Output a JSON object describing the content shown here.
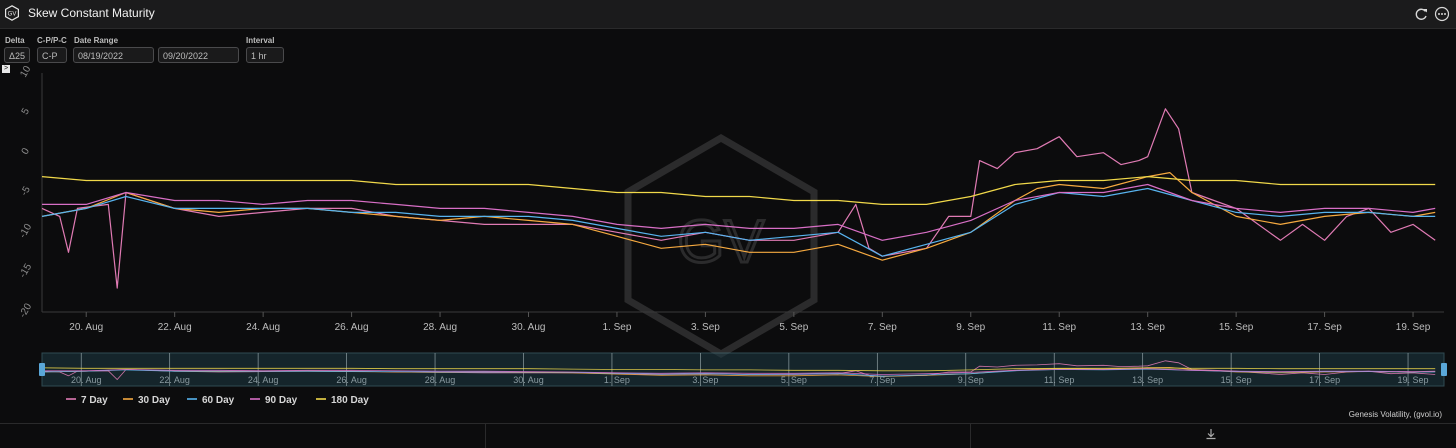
{
  "header": {
    "title": "Skew Constant Maturity",
    "logo_text": "GV",
    "refresh_icon": "refresh-icon",
    "menu_icon": "more-icon"
  },
  "controls": {
    "delta": {
      "label": "Delta",
      "value": "Δ25"
    },
    "mode": {
      "label": "C-P/P-C",
      "value": "C-P"
    },
    "date_range": {
      "label": "Date Range",
      "start": "08/19/2022",
      "end": "09/20/2022"
    },
    "interval": {
      "label": "Interval",
      "value": "1 hr"
    },
    "toggle_glyph": ">"
  },
  "credit": "Genesis Volatility, (gvol.io)",
  "colors": {
    "s7": "#e07bb4",
    "s30": "#f5a940",
    "s60": "#58b4ef",
    "s90": "#d86fc6",
    "s180": "#f1d94a"
  },
  "chart_data": {
    "type": "line",
    "title": "",
    "xlabel": "",
    "ylabel": "",
    "ylim": [
      -20,
      10
    ],
    "yticks": [
      "10",
      "5",
      "0",
      "-5",
      "-10",
      "-15",
      "-20"
    ],
    "xrange_days": [
      0,
      31.7
    ],
    "xticks": [
      {
        "day": 1,
        "label": "20. Aug"
      },
      {
        "day": 3,
        "label": "22. Aug"
      },
      {
        "day": 5,
        "label": "24. Aug"
      },
      {
        "day": 7,
        "label": "26. Aug"
      },
      {
        "day": 9,
        "label": "28. Aug"
      },
      {
        "day": 11,
        "label": "30. Aug"
      },
      {
        "day": 13,
        "label": "1. Sep"
      },
      {
        "day": 15,
        "label": "3. Sep"
      },
      {
        "day": 17,
        "label": "5. Sep"
      },
      {
        "day": 19,
        "label": "7. Sep"
      },
      {
        "day": 21,
        "label": "9. Sep"
      },
      {
        "day": 23,
        "label": "11. Sep"
      },
      {
        "day": 25,
        "label": "13. Sep"
      },
      {
        "day": 27,
        "label": "15. Sep"
      },
      {
        "day": 29,
        "label": "17. Sep"
      },
      {
        "day": 31,
        "label": "19. Sep"
      }
    ],
    "legend_position": "bottom-left",
    "series": [
      {
        "name": "7 Day",
        "color": "#e07bb4",
        "points": [
          [
            0,
            -7
          ],
          [
            0.4,
            -8
          ],
          [
            0.6,
            -12.5
          ],
          [
            0.8,
            -7
          ],
          [
            1.5,
            -6.5
          ],
          [
            1.7,
            -17
          ],
          [
            1.9,
            -5
          ],
          [
            3,
            -7
          ],
          [
            4,
            -8
          ],
          [
            5,
            -7.5
          ],
          [
            6,
            -7
          ],
          [
            7,
            -7
          ],
          [
            8,
            -8
          ],
          [
            9,
            -8.5
          ],
          [
            10,
            -9
          ],
          [
            11,
            -9
          ],
          [
            12,
            -9
          ],
          [
            13,
            -10
          ],
          [
            14,
            -11
          ],
          [
            15,
            -10
          ],
          [
            16,
            -11
          ],
          [
            17,
            -11
          ],
          [
            18,
            -10
          ],
          [
            18.4,
            -6.5
          ],
          [
            18.7,
            -12
          ],
          [
            19,
            -13
          ],
          [
            20,
            -12
          ],
          [
            20.5,
            -8
          ],
          [
            21,
            -8
          ],
          [
            21.2,
            -1
          ],
          [
            21.6,
            -2
          ],
          [
            22,
            0
          ],
          [
            22.5,
            0.5
          ],
          [
            23,
            2
          ],
          [
            23.4,
            -0.5
          ],
          [
            24,
            0
          ],
          [
            24.4,
            -1.5
          ],
          [
            24.8,
            -1
          ],
          [
            25,
            -0.5
          ],
          [
            25.4,
            5.5
          ],
          [
            25.7,
            3
          ],
          [
            26,
            -5
          ],
          [
            26.5,
            -6
          ],
          [
            27,
            -7
          ],
          [
            27.5,
            -9
          ],
          [
            28,
            -11
          ],
          [
            28.5,
            -9
          ],
          [
            29,
            -11
          ],
          [
            29.5,
            -8
          ],
          [
            30,
            -7
          ],
          [
            30.5,
            -10
          ],
          [
            31,
            -9
          ],
          [
            31.5,
            -11
          ]
        ]
      },
      {
        "name": "30 Day",
        "color": "#f5a940",
        "points": [
          [
            0,
            -8
          ],
          [
            1,
            -7
          ],
          [
            1.9,
            -5
          ],
          [
            3,
            -7
          ],
          [
            4,
            -7.5
          ],
          [
            5,
            -7
          ],
          [
            6,
            -7
          ],
          [
            7,
            -7.5
          ],
          [
            8,
            -8
          ],
          [
            9,
            -8.5
          ],
          [
            10,
            -8
          ],
          [
            11,
            -8.5
          ],
          [
            12,
            -9
          ],
          [
            13,
            -10.5
          ],
          [
            14,
            -12
          ],
          [
            15,
            -11.5
          ],
          [
            16,
            -12.5
          ],
          [
            17,
            -12.5
          ],
          [
            18,
            -11.5
          ],
          [
            19,
            -13.5
          ],
          [
            20,
            -12
          ],
          [
            21,
            -10
          ],
          [
            22,
            -6
          ],
          [
            22.5,
            -4.5
          ],
          [
            23,
            -4
          ],
          [
            24,
            -4.5
          ],
          [
            25,
            -3
          ],
          [
            25.5,
            -2.5
          ],
          [
            26,
            -5
          ],
          [
            27,
            -8
          ],
          [
            28,
            -9
          ],
          [
            29,
            -8
          ],
          [
            30,
            -7.5
          ],
          [
            31,
            -8
          ],
          [
            31.5,
            -7.5
          ]
        ]
      },
      {
        "name": "60 Day",
        "color": "#58b4ef",
        "points": [
          [
            0,
            -8
          ],
          [
            1,
            -7
          ],
          [
            1.9,
            -5.5
          ],
          [
            3,
            -7
          ],
          [
            4,
            -7
          ],
          [
            5,
            -7
          ],
          [
            6,
            -7
          ],
          [
            7,
            -7.5
          ],
          [
            8,
            -7.5
          ],
          [
            9,
            -8
          ],
          [
            10,
            -8
          ],
          [
            11,
            -8
          ],
          [
            12,
            -8.5
          ],
          [
            13,
            -9.5
          ],
          [
            14,
            -10.5
          ],
          [
            15,
            -10
          ],
          [
            16,
            -11
          ],
          [
            17,
            -10.5
          ],
          [
            18,
            -10
          ],
          [
            19,
            -13
          ],
          [
            20,
            -11.5
          ],
          [
            21,
            -10
          ],
          [
            22,
            -6.5
          ],
          [
            23,
            -5
          ],
          [
            24,
            -5.5
          ],
          [
            25,
            -4.5
          ],
          [
            26,
            -6
          ],
          [
            27,
            -7.5
          ],
          [
            28,
            -8
          ],
          [
            29,
            -7.5
          ],
          [
            30,
            -7.5
          ],
          [
            31,
            -8
          ],
          [
            31.5,
            -8
          ]
        ]
      },
      {
        "name": "90 Day",
        "color": "#d86fc6",
        "points": [
          [
            0,
            -6.5
          ],
          [
            1,
            -6.5
          ],
          [
            1.9,
            -5
          ],
          [
            3,
            -6
          ],
          [
            4,
            -6
          ],
          [
            5,
            -6.5
          ],
          [
            6,
            -6
          ],
          [
            7,
            -6
          ],
          [
            8,
            -6.5
          ],
          [
            9,
            -7
          ],
          [
            10,
            -7
          ],
          [
            11,
            -7.5
          ],
          [
            12,
            -8
          ],
          [
            13,
            -9
          ],
          [
            14,
            -9.5
          ],
          [
            15,
            -9
          ],
          [
            16,
            -9.5
          ],
          [
            17,
            -9.5
          ],
          [
            18,
            -9
          ],
          [
            19,
            -11
          ],
          [
            20,
            -10
          ],
          [
            21,
            -8.5
          ],
          [
            22,
            -6
          ],
          [
            23,
            -5
          ],
          [
            24,
            -5
          ],
          [
            25,
            -4
          ],
          [
            26,
            -6
          ],
          [
            27,
            -7
          ],
          [
            28,
            -7.5
          ],
          [
            29,
            -7
          ],
          [
            30,
            -7
          ],
          [
            31,
            -7.5
          ],
          [
            31.5,
            -7
          ]
        ]
      },
      {
        "name": "180 Day",
        "color": "#f1d94a",
        "points": [
          [
            0,
            -3
          ],
          [
            1,
            -3.5
          ],
          [
            2,
            -3.5
          ],
          [
            3,
            -3.5
          ],
          [
            4,
            -3.5
          ],
          [
            5,
            -3.5
          ],
          [
            6,
            -3.5
          ],
          [
            7,
            -3.5
          ],
          [
            8,
            -4
          ],
          [
            9,
            -4
          ],
          [
            10,
            -4
          ],
          [
            11,
            -4
          ],
          [
            12,
            -4.5
          ],
          [
            13,
            -5
          ],
          [
            14,
            -5
          ],
          [
            15,
            -5.5
          ],
          [
            16,
            -5.5
          ],
          [
            17,
            -6
          ],
          [
            18,
            -6
          ],
          [
            19,
            -6.5
          ],
          [
            20,
            -6.5
          ],
          [
            21,
            -5.5
          ],
          [
            22,
            -4
          ],
          [
            23,
            -3.5
          ],
          [
            24,
            -3.5
          ],
          [
            25,
            -3
          ],
          [
            26,
            -3.5
          ],
          [
            27,
            -3.5
          ],
          [
            28,
            -4
          ],
          [
            29,
            -4
          ],
          [
            30,
            -4
          ],
          [
            31,
            -4
          ],
          [
            31.5,
            -4
          ]
        ]
      }
    ]
  }
}
